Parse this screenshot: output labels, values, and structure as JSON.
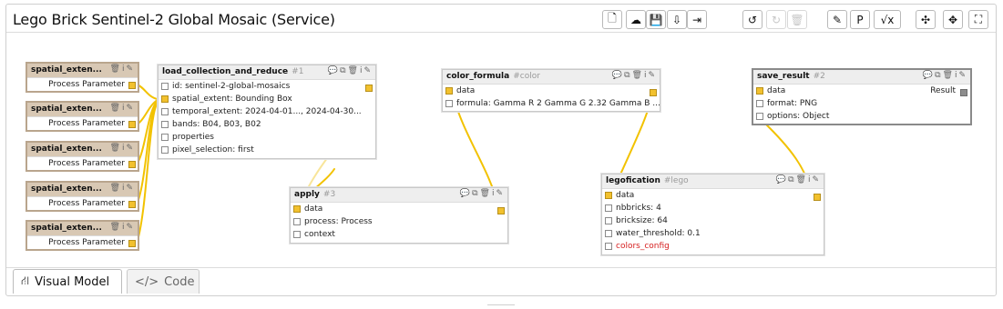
{
  "title": "Lego Brick Sentinel-2 Global Mosaic (Service)",
  "toolbar": {
    "groups": [
      [
        "file-icon",
        "cloud-download-icon",
        "save-icon",
        "file-download-icon",
        "export-icon"
      ],
      [
        "undo-icon",
        "redo-icon",
        "delete-icon"
      ],
      [
        "edit-icon",
        "parameter-icon",
        "math-icon"
      ],
      [
        "compact-icon",
        "move-icon",
        "fullscreen-icon"
      ]
    ],
    "glyphs": {
      "file-icon": "🗋",
      "cloud-download-icon": "☁",
      "save-icon": "💾",
      "file-download-icon": "⇩",
      "export-icon": "⇥",
      "undo-icon": "↺",
      "redo-icon": "↻",
      "delete-icon": "🗑",
      "edit-icon": "✎",
      "parameter-icon": "P",
      "math-icon": "√x",
      "compact-icon": "✣",
      "move-icon": "✥",
      "fullscreen-icon": "⛶"
    },
    "disabled": [
      "redo-icon",
      "delete-icon"
    ]
  },
  "param_nodes": [
    {
      "title": "spatial_exten...",
      "label": "Process Parameter"
    },
    {
      "title": "spatial_exten...",
      "label": "Process Parameter"
    },
    {
      "title": "spatial_exten...",
      "label": "Process Parameter"
    },
    {
      "title": "spatial_exten...",
      "label": "Process Parameter"
    },
    {
      "title": "spatial_exten...",
      "label": "Process Parameter"
    }
  ],
  "nodes": {
    "load": {
      "title": "load_collection_and_reduce",
      "id": "#1",
      "rows": [
        "id: sentinel-2-global-mosaics",
        "spatial_extent: Bounding Box",
        "temporal_extent: 2024-04-01..., 2024-04-30...",
        "bands: B04, B03, B02",
        "properties",
        "pixel_selection: first"
      ]
    },
    "apply": {
      "title": "apply",
      "id": "#3",
      "rows": [
        "data",
        "process: Process",
        "context"
      ]
    },
    "color": {
      "title": "color_formula",
      "id": "#color",
      "rows": [
        "data",
        "formula: Gamma R 2 Gamma G 2.32 Gamma B ..."
      ]
    },
    "lego": {
      "title": "legofication",
      "id": "#lego",
      "rows": [
        "data",
        "nbbricks: 4",
        "bricksize: 64",
        "water_threshold: 0.1",
        "colors_config"
      ]
    },
    "save": {
      "title": "save_result",
      "id": "#2",
      "rows": [
        "data",
        "format: PNG",
        "options: Object"
      ],
      "result_label": "Result"
    }
  },
  "node_icons": "💬⧉🗑i✎",
  "param_icons": "🗑i✎",
  "tabs": [
    {
      "label": "Visual Model",
      "icon": "diagram-icon",
      "glyph": "⛙"
    },
    {
      "label": "Code",
      "icon": "code-icon",
      "glyph": "</>"
    }
  ],
  "colors": {
    "edge": "#f2c200",
    "edge_faded": "#f8e59a",
    "param_header": "#d8c8b4",
    "port": "#f2c12e"
  }
}
